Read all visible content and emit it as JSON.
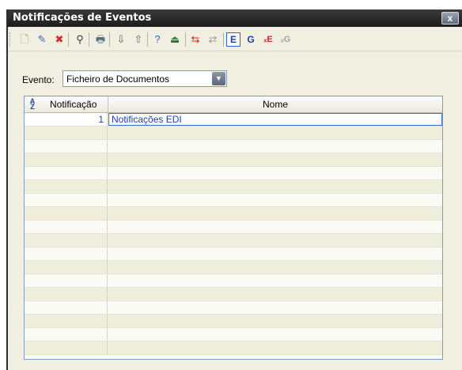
{
  "window": {
    "title": "Notificações de Eventos",
    "close_symbol": "x"
  },
  "toolbar": {
    "buttons": [
      {
        "name": "new-icon",
        "glyph": "🗋",
        "color": "#c89a2a"
      },
      {
        "name": "edit-icon",
        "glyph": "✎",
        "color": "#3b6bbd"
      },
      {
        "name": "delete-icon",
        "glyph": "✖",
        "color": "#d02a2a"
      },
      {
        "name": "find-icon",
        "glyph": "⚲",
        "color": "#3b3b3b"
      },
      {
        "name": "print-icon",
        "glyph": "🖶",
        "color": "#5a6b80"
      },
      {
        "name": "import-icon",
        "glyph": "⇩",
        "color": "#7b5a2b"
      },
      {
        "name": "export-icon",
        "glyph": "⇧",
        "color": "#6b6b6b"
      },
      {
        "name": "help-icon",
        "glyph": "?",
        "color": "#2b64c8"
      },
      {
        "name": "exit-icon",
        "glyph": "⏏",
        "color": "#2a7a3a"
      },
      {
        "name": "move-left-icon",
        "glyph": "⇆",
        "color": "#d42020"
      },
      {
        "name": "move-right-icon",
        "glyph": "⇄",
        "color": "#9a9a9a"
      },
      {
        "name": "e-mode-icon",
        "glyph": "E",
        "color": "#1c3fa8"
      },
      {
        "name": "g-mode-icon",
        "glyph": "G",
        "color": "#1c3fa8"
      },
      {
        "name": "remove-e-icon",
        "glyph": "ₓE",
        "color": "#d42020"
      },
      {
        "name": "remove-g-icon",
        "glyph": "ₓG",
        "color": "#a0a0a0"
      }
    ]
  },
  "filter": {
    "label": "Evento:",
    "value": "Ficheiro de Documentos"
  },
  "grid": {
    "columns": [
      "Notificação",
      "Nome"
    ],
    "rows": [
      {
        "num": "1",
        "name": "Notificações EDI"
      }
    ],
    "empty_rows": 17
  }
}
